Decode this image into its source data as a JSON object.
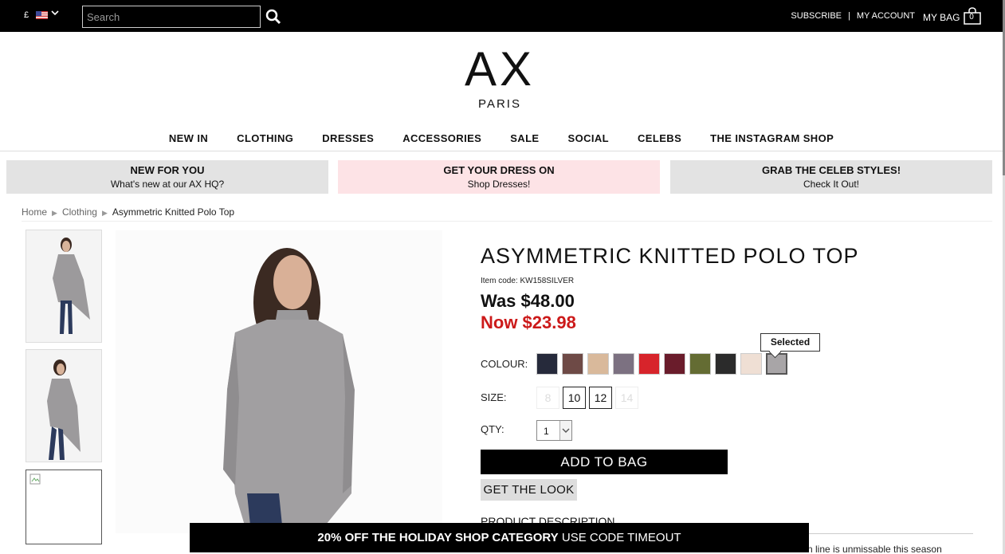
{
  "topbar": {
    "currency": "£",
    "search_placeholder": "Search",
    "subscribe": "SUBSCRIBE",
    "separator": "|",
    "my_account": "MY ACCOUNT",
    "my_bag": "MY BAG",
    "bag_count": "0"
  },
  "logo": {
    "brand": "AX",
    "sub": "PARIS"
  },
  "nav": [
    "NEW IN",
    "CLOTHING",
    "DRESSES",
    "ACCESSORIES",
    "SALE",
    "SOCIAL",
    "CELEBS",
    "THE INSTAGRAM SHOP"
  ],
  "promos": [
    {
      "title": "NEW FOR YOU",
      "sub": "What's new at our AX HQ?",
      "bg": "#e3e3e3"
    },
    {
      "title": "GET YOUR DRESS ON",
      "sub": "Shop Dresses!",
      "bg": "#fde3e6"
    },
    {
      "title": "GRAB THE CELEB STYLES!",
      "sub": "Check It Out!",
      "bg": "#e3e3e3"
    }
  ],
  "breadcrumb": [
    "Home",
    "Clothing",
    "Asymmetric Knitted Polo Top"
  ],
  "product": {
    "title": "ASYMMETRIC KNITTED POLO TOP",
    "item_code": "Item code: KW158SILVER",
    "was_price": "Was $48.00",
    "now_price": "Now $23.98",
    "colour_label": "COLOUR:",
    "size_label": "SIZE:",
    "qty_label": "QTY:",
    "qty_value": "1",
    "selected_tooltip": "Selected",
    "colours": [
      "#262a3b",
      "#6e4a46",
      "#d9b99b",
      "#7c7181",
      "#d7242b",
      "#6a1c2b",
      "#646c33",
      "#2b2b2b",
      "#efdfd4",
      "#a8a5a7"
    ],
    "sizes": [
      {
        "label": "8",
        "available": false
      },
      {
        "label": "10",
        "available": true
      },
      {
        "label": "12",
        "available": true
      },
      {
        "label": "14",
        "available": false
      }
    ],
    "add_to_bag": "ADD TO BAG",
    "get_the_look": "GET THE LOOK",
    "description_heading": "PRODUCT DESCRIPTION",
    "description_snippet": "n line is unmissable this season"
  },
  "footer_promo": {
    "bold": "20% OFF THE HOLIDAY SHOP CATEGORY",
    "rest": " USE CODE TIMEOUT"
  }
}
